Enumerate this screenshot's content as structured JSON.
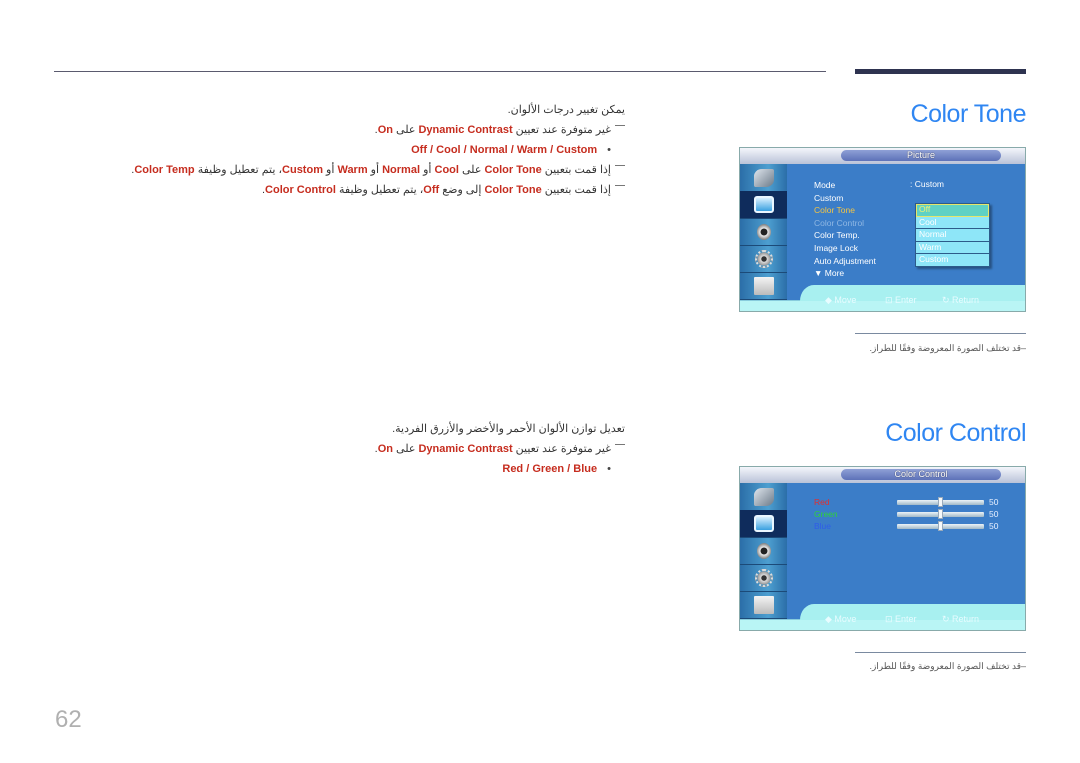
{
  "page_number": "62",
  "sections": [
    {
      "title": "Color Tone",
      "intro": "يمكن تغيير درجات الألوان.",
      "note_dynamic": {
        "pre": "غير متوفرة عند تعيين ",
        "term": "Dynamic Contrast",
        "mid": " على ",
        "value": "On",
        "post": "."
      },
      "options": [
        "Off",
        "Cool",
        "Normal",
        "Warm",
        "Custom"
      ],
      "note_temp": {
        "pre": "إذا قمت بتعيين ",
        "term": "Color Tone",
        "mid1": " على ",
        "v1": "Cool",
        "or1": " أو ",
        "v2": "Normal",
        "or2": " أو ",
        "v3": "Warm",
        "or3": " أو ",
        "v4": "Custom",
        "mid2": "، يتم تعطيل وظيفة ",
        "term2": "Color Temp",
        "post": "."
      },
      "note_control": {
        "pre": "إذا قمت بتعيين ",
        "term": "Color Tone",
        "mid1": " إلى وضع ",
        "v1": "Off",
        "mid2": "، يتم تعطيل وظيفة ",
        "term2": "Color Control",
        "post": "."
      },
      "osd": {
        "header": "Picture",
        "menu": [
          {
            "label": "Mode",
            "value": ": Custom"
          },
          {
            "label": "Custom",
            "value": ""
          },
          {
            "label": "Color Tone",
            "value": ""
          },
          {
            "label": "Color Control",
            "value": ""
          },
          {
            "label": "Color Temp.",
            "value": ""
          },
          {
            "label": "Image Lock",
            "value": ""
          },
          {
            "label": "Auto Adjustment",
            "value": ""
          },
          {
            "label": "▼ More",
            "value": ""
          }
        ],
        "dropdown": [
          "Off",
          "Cool",
          "Normal",
          "Warm",
          "Custom"
        ],
        "dropdown_selected": "Off",
        "footer": {
          "move": "◆ Move",
          "enter": "⊡ Enter",
          "return": "↻ Return"
        }
      },
      "caption": "–قد تختلف الصورة المعروضة وفقًا للطراز."
    },
    {
      "title": "Color Control",
      "intro": "تعديل توازن الألوان الأحمر والأخضر والأزرق الفردية.",
      "note_dynamic": {
        "pre": "غير متوفرة عند تعيين ",
        "term": "Dynamic Contrast",
        "mid": " على ",
        "value": "On",
        "post": "."
      },
      "options": [
        "Red",
        "Green",
        "Blue"
      ],
      "osd": {
        "header": "Color Control",
        "sliders": [
          {
            "label": "Red",
            "value": 50,
            "max": 100,
            "color": "#e03030"
          },
          {
            "label": "Green",
            "value": 50,
            "max": 100,
            "color": "#2ed23a"
          },
          {
            "label": "Blue",
            "value": 50,
            "max": 100,
            "color": "#2f5de8"
          }
        ],
        "footer": {
          "move": "◆ Move",
          "enter": "⊡ Enter",
          "return": "↻ Return"
        }
      },
      "caption": "–قد تختلف الصورة المعروضة وفقًا للطراز."
    }
  ],
  "colors": {
    "accent_title": "#2f86f2",
    "highlight": "#c62d1f"
  }
}
